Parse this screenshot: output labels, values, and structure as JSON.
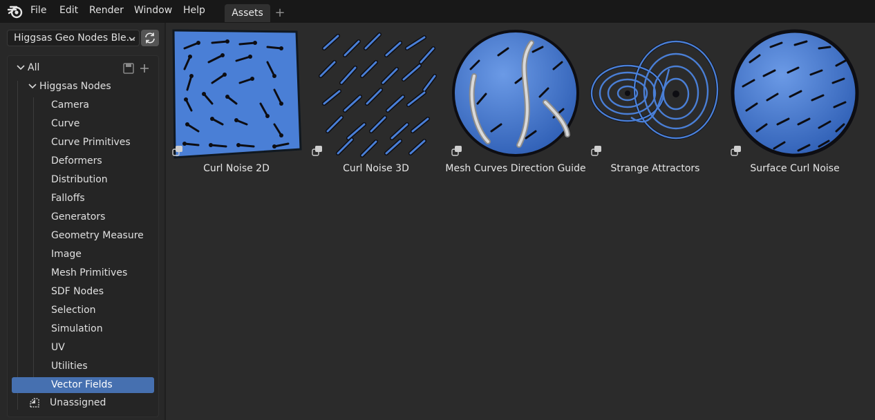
{
  "menubar": {
    "items": [
      "File",
      "Edit",
      "Render",
      "Window",
      "Help"
    ],
    "tabs": [
      {
        "label": "Assets",
        "active": true
      }
    ],
    "add_tab_icon": "plus-icon"
  },
  "sidebar": {
    "library": "Higgsas Geo Nodes Ble...",
    "tree": {
      "root": "All",
      "group": "Higgsas Nodes",
      "categories": [
        "Camera",
        "Curve",
        "Curve Primitives",
        "Deformers",
        "Distribution",
        "Falloffs",
        "Generators",
        "Geometry Measure",
        "Image",
        "Mesh Primitives",
        "SDF Nodes",
        "Selection",
        "Simulation",
        "UV",
        "Utilities",
        "Vector Fields"
      ],
      "selected": "Vector Fields",
      "unassigned": "Unassigned"
    }
  },
  "assets": [
    {
      "name": "Curl Noise 2D",
      "thumbnail": "square-arrows"
    },
    {
      "name": "Curl Noise 3D",
      "thumbnail": "arrow-cloud"
    },
    {
      "name": "Mesh Curves Direction Guide",
      "thumbnail": "sphere-curves"
    },
    {
      "name": "Strange Attractors",
      "thumbnail": "attractor"
    },
    {
      "name": "Surface Curl Noise",
      "thumbnail": "sphere-arrows"
    }
  ],
  "colors": {
    "accent": "#4670b0",
    "thumb_blue": "#4a7fd6"
  }
}
